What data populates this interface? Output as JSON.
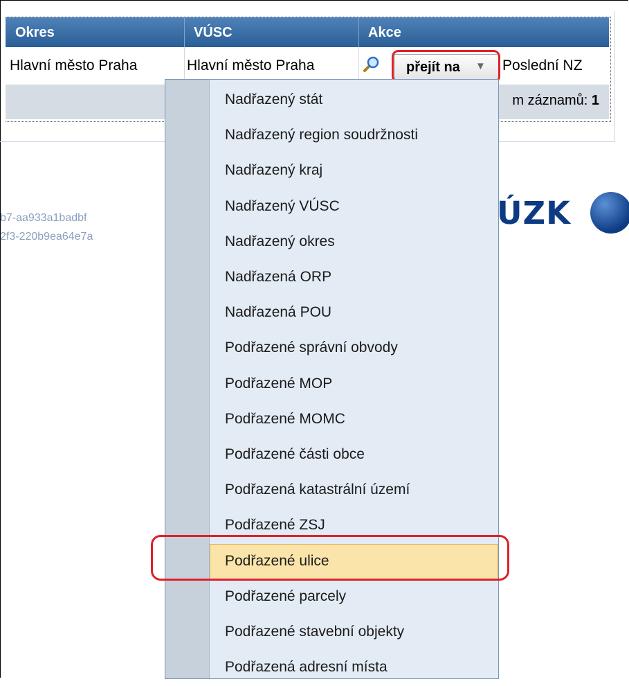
{
  "table": {
    "columns": [
      "Okres",
      "VÚSC",
      "Akce"
    ],
    "row": {
      "okres": "Hlavní město Praha",
      "vusc": "Hlavní město Praha",
      "last_link": "Poslední NZ"
    },
    "footer_label": "m záznamů:",
    "footer_count": "1"
  },
  "goto_button": {
    "label": "přejít na",
    "arrow": "▼"
  },
  "ids": [
    "b7-aa933a1badbf",
    "2f3-220b9ea64e7a"
  ],
  "logo": {
    "text": "ÚZK"
  },
  "menu": {
    "items": [
      "Nadřazený stát",
      "Nadřazený region soudržnosti",
      "Nadřazený kraj",
      "Nadřazený VÚSC",
      "Nadřazený okres",
      "Nadřazená ORP",
      "Nadřazená POU",
      "Podřazené správní obvody",
      "Podřazené MOP",
      "Podřazené MOMC",
      "Podřazené části obce",
      "Podřazená katastrální území",
      "Podřazené ZSJ",
      "Podřazené ulice",
      "Podřazené parcely",
      "Podřazené stavební objekty",
      "Podřazená adresní místa"
    ],
    "selected_index": 13
  },
  "colors": {
    "header_bg": "#2a5e96",
    "highlight_ring": "#e0202a",
    "selected_item": "#fbe4aa"
  }
}
